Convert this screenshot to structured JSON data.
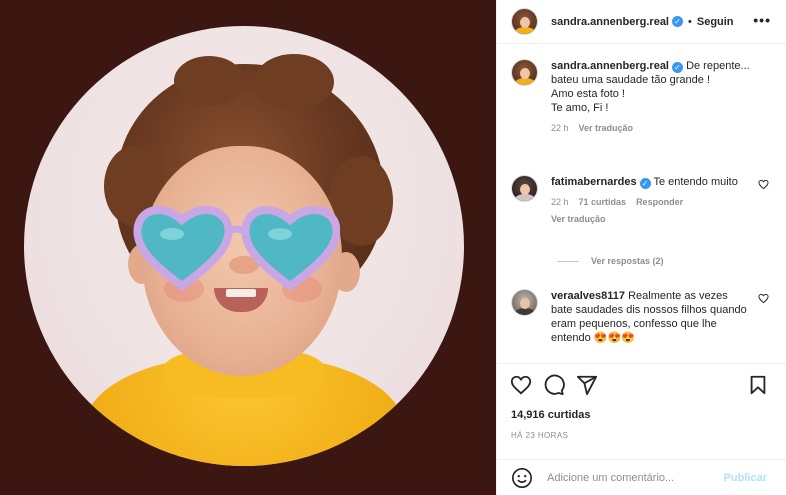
{
  "post": {
    "author": "sandra.annenberg.real",
    "follow_dot": "•",
    "follow_label": "Seguin",
    "more_label": "•••"
  },
  "caption": {
    "username": "sandra.annenberg.real",
    "text": "De repente... bateu uma saudade tão grande !\nAmo esta foto !\nTe amo, Fi !",
    "time": "22 h",
    "translate": "Ver tradução"
  },
  "comments": [
    {
      "username": "fatimabernardes",
      "verified": true,
      "text": "Te entendo muito",
      "time": "22 h",
      "likes": "71 curtidas",
      "reply": "Responder",
      "translate": "Ver tradução"
    },
    {
      "username": "veraalves8117",
      "verified": false,
      "text": "Realmente as vezes bate saudades dis nossos filhos quando eram pequenos, confesso que lhe entendo 😍😍😍"
    }
  ],
  "replies_label": "Ver respostas (2)",
  "likes_count": "14,916 curtidas",
  "time_ago": "HÁ 23 HORAS",
  "add_comment": {
    "placeholder": "Adicione um comentário...",
    "publish_label": "Publicar"
  },
  "icons": [
    "heart-icon",
    "comment-icon",
    "share-icon",
    "bookmark-icon",
    "emoji-icon",
    "verified-icon",
    "more-icon"
  ],
  "colors": {
    "media_background": "#3c1712",
    "verified_blue": "#3897f0",
    "publish_disabled": "#b2dffc",
    "secondary_text": "#8e8e8e"
  }
}
